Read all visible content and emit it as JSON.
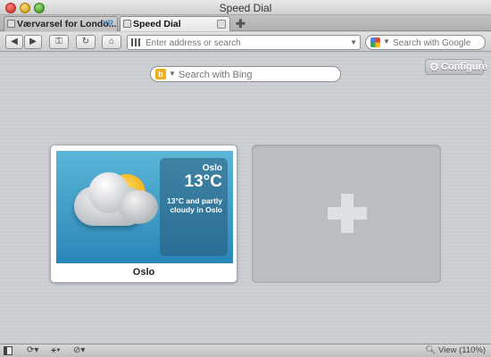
{
  "window": {
    "title": "Speed Dial"
  },
  "tabs": [
    {
      "label": "Værvarsel for Londo...",
      "badge": "YR"
    },
    {
      "label": "Speed Dial"
    }
  ],
  "toolbar": {
    "address_placeholder": "Enter address or search",
    "search_placeholder": "Search with Google"
  },
  "content": {
    "bing_placeholder": "Search with Bing",
    "configure_label": "Configure",
    "dials": [
      {
        "label": "Oslo",
        "weather": {
          "city": "Oslo",
          "temperature": "13°C",
          "description": "13°C and partly cloudy in Oslo"
        }
      }
    ]
  },
  "statusbar": {
    "zoom": "View (110%)"
  },
  "colors": {
    "sky_top": "#5cb6d8",
    "sky_bottom": "#2a86b8",
    "accent_bing": "#f2b01e"
  }
}
